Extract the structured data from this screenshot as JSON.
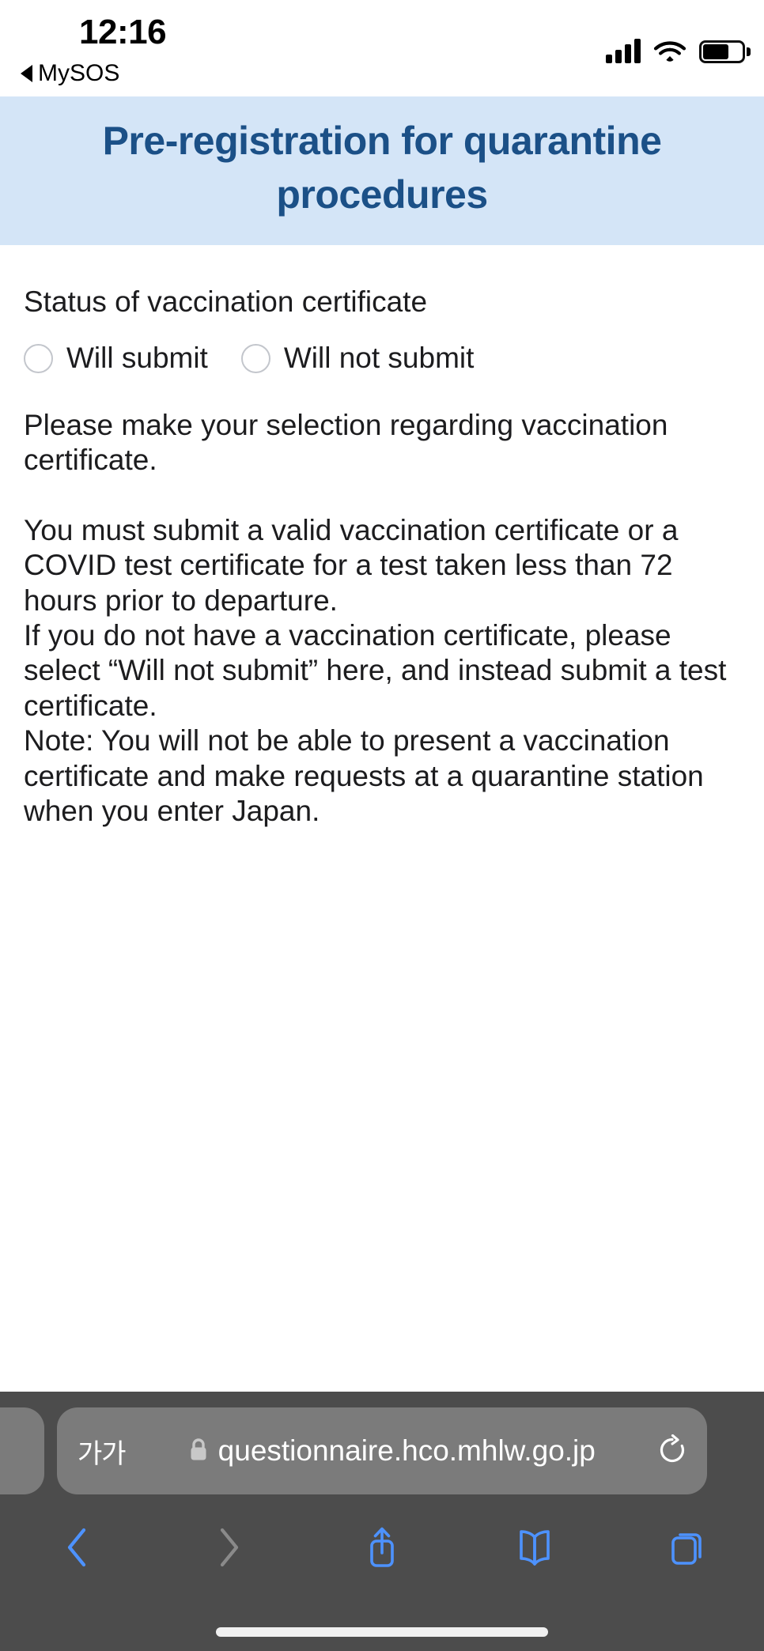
{
  "status_bar": {
    "time": "12:16",
    "back_app_label": "MySOS",
    "back_icon": "triangle-left-icon",
    "cellular_icon": "cellular-signal-icon",
    "wifi_icon": "wifi-icon",
    "battery_icon": "battery-icon",
    "battery_level_pct": 70
  },
  "page": {
    "header_title": "Pre-registration for quarantine procedures",
    "header_bg_color": "#d4e5f7",
    "header_text_color": "#1b5087",
    "question_label": "Status of vaccination certificate",
    "options": [
      {
        "label": "Will submit",
        "selected": false
      },
      {
        "label": "Will not submit",
        "selected": false
      }
    ],
    "instruction_paragraphs": [
      "Please make your selection regarding vaccination certificate.",
      "You must submit a valid vaccination certificate or a COVID test certificate for a test taken less than 72 hours prior to departure.",
      "If you do not have a vaccination certificate, please select “Will not submit” here, and instead submit a test certificate.",
      "Note: You will not be able to present a vaccination certificate and make requests at a quarantine station when you enter Japan."
    ]
  },
  "browser": {
    "text_size_button_label": "가가",
    "lock_icon": "lock-icon",
    "url": "questionnaire.hco.mhlw.go.jp",
    "reload_icon": "reload-icon",
    "toolbar": [
      {
        "name": "back-button",
        "icon": "chevron-left-icon",
        "enabled": true
      },
      {
        "name": "forward-button",
        "icon": "chevron-right-icon",
        "enabled": false
      },
      {
        "name": "share-button",
        "icon": "share-icon",
        "enabled": true
      },
      {
        "name": "bookmarks-button",
        "icon": "book-icon",
        "enabled": true
      },
      {
        "name": "tabs-button",
        "icon": "tabs-icon",
        "enabled": true
      }
    ],
    "accent_color": "#4d92ff",
    "disabled_color": "#8a8a8a",
    "chrome_bg_color": "#4c4c4c",
    "urlbar_bg_color": "#7b7b7b"
  }
}
